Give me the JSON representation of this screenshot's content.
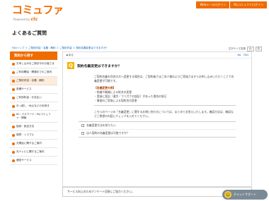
{
  "header": {
    "logo": "コミュファ",
    "logo_sub_prefix": "Powered by",
    "logo_sub_brand": "ctc",
    "links": [
      "Webメールログイン",
      "Myコミュファログイン"
    ]
  },
  "page_title": "よくあるご質問",
  "breadcrumb": "FAQトップ ＞ ご契約内容・名義・解約 ＞ ご契約内容 ＞ 契約名義変更はできますか？",
  "font_size": {
    "label": "文字サイズ変更",
    "small": "小",
    "medium": "中"
  },
  "sidebar": {
    "title": "契約から探す",
    "items": [
      "お申し込みをご検討中のお客さま",
      "ご利用開始・開通までのご案内",
      "ご契約内容・名義・解約",
      "各種サービス",
      "ご利用料金・お支払い",
      "引っ越し・休止などの手続き",
      "ID・パスワード・Myコミュファ・情報",
      "接続・設定方法",
      "故障・トラブル",
      "光電話に関するご案内",
      "光テレビに関するご案内",
      "通信サービス"
    ]
  },
  "main": {
    "back": "◀ 戻る",
    "nav_links": [
      "No",
      "FAQ"
    ],
    "question": "契約名義変更はできますか？",
    "answer": [
      "ご契約名義を同名の方へ変更する場合は、ご契約者さまご本人様およびご家族さまからお申し込みいただくことで名義変更が可能です。"
    ],
    "examples_title": "【名義変更の例】",
    "examples": [
      "・結婚や離婚による姓名の変更",
      "・登録に誤記（漢字／フリガナの誤記）があった場合の修正",
      "・事務のご家族による契約名の変更"
    ],
    "note": "こちらのページの「名義変更」に関するお問い合わせについては、まとめてお答えいたします。確認方法は、確認などご希望の内容にチェックを入れてください。",
    "related": [
      "名義変更方法を知りたい",
      "法人契約の名義変更は可能ですか？"
    ]
  },
  "survey": "サービス向上のためアンケート回答にご協力ください。",
  "chatbot": "チャットサポート"
}
